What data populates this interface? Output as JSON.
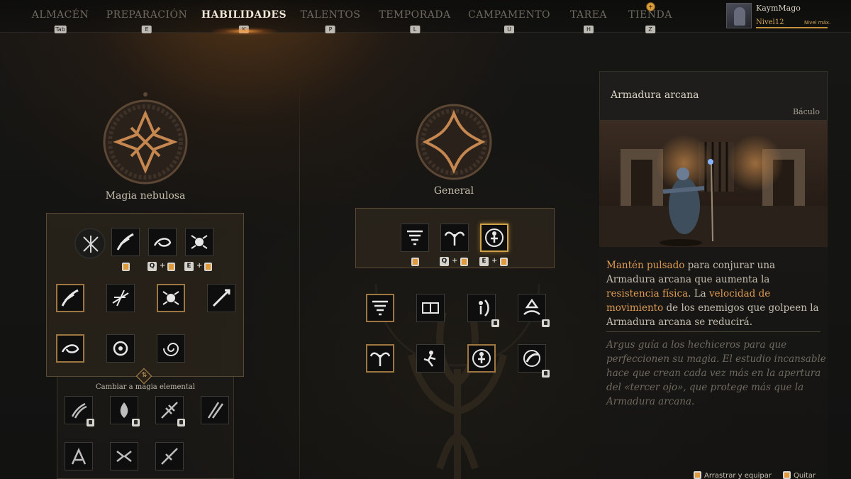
{
  "nav": {
    "tabs": [
      {
        "label": "ALMACÉN",
        "key": "Tab"
      },
      {
        "label": "PREPARACIÓN",
        "key": "E"
      },
      {
        "label": "HABILIDADES",
        "key": "K"
      },
      {
        "label": "TALENTOS",
        "key": "P"
      },
      {
        "label": "TEMPORADA",
        "key": "L"
      },
      {
        "label": "CAMPAMENTO",
        "key": "U"
      },
      {
        "label": "TAREA",
        "key": "H"
      },
      {
        "label": "TIENDA",
        "key": "Z"
      }
    ],
    "active_tab": "HABILIDADES",
    "shop_badge": "+"
  },
  "profile": {
    "name": "KaymMago",
    "level": "Nivel12",
    "level_max": "Nivel máx."
  },
  "left": {
    "school_title": "Magia nebulosa",
    "bind_keys": {
      "q": "Q",
      "e": "E",
      "plus": "+"
    },
    "switch_label": "Cambiar a magia elemental",
    "switch_icon": "⇅"
  },
  "middle": {
    "school_title": "General",
    "bind_keys": {
      "q": "Q",
      "e": "E",
      "plus": "+"
    }
  },
  "detail": {
    "title": "Armadura arcana",
    "weapon": "Báculo",
    "desc": {
      "hl1": "Mantén pulsado",
      "t1": " para conjurar una Armadura arcana que aumenta la ",
      "hl2": "resistencia física",
      "t2": ". La ",
      "hl3": "velocidad de movimiento",
      "t3": " de los enemigos que golpeen la Armadura arcana se reducirá."
    },
    "lore": "Argus guía a los hechiceros para que perfeccionen su magia. El estudio incansable hace que crean cada vez más en la apertura del «tercer ojo», que protege más que la Armadura arcana."
  },
  "hints": {
    "drag": "Arrastrar y equipar",
    "quit": "Quitar"
  },
  "colors": {
    "accent": "#d2a248",
    "highlight_text": "#dd9a52",
    "background": "#141412"
  }
}
